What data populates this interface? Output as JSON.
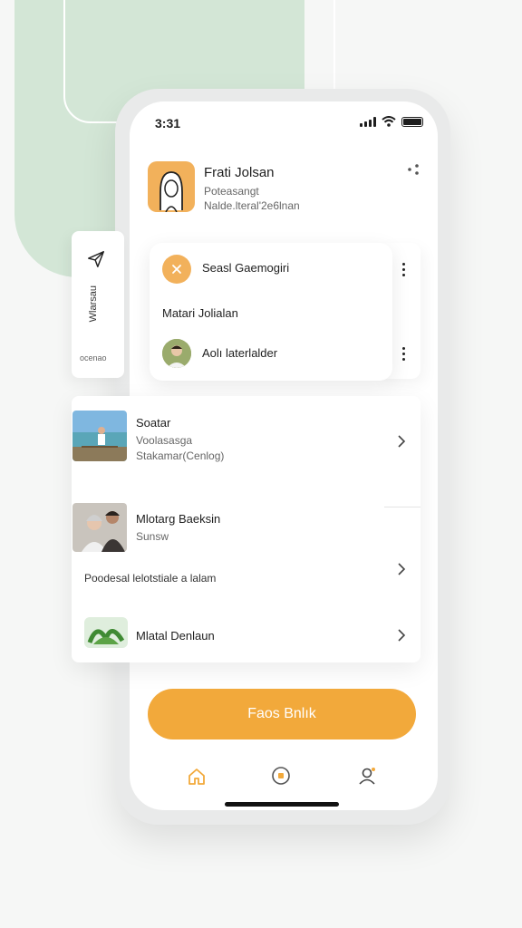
{
  "status": {
    "time": "3:31"
  },
  "profile": {
    "name": "Frati Jolsan",
    "line1": "Poteasangt",
    "line2": "Nalde.lteral'2e6lnan"
  },
  "side_tab": {
    "vertical_label": "Wlarsau",
    "bottom_label": "ocenao"
  },
  "card": {
    "title": "Seasl Gaemogiri",
    "middle": "Matari Jolialan",
    "item": "Aolı laterlalder"
  },
  "list": {
    "items": [
      {
        "title": "Soatar",
        "line1": "Voolasasga",
        "line2": "Stakamar(Cenlog)"
      },
      {
        "title": "Mlotarg Baeksin",
        "line1": "Sunsw",
        "extra": "Poodesal lelotstiale a lalam"
      },
      {
        "title": "Mlatal Denlaun"
      }
    ]
  },
  "cta": {
    "label": "Faos Bnlık"
  },
  "colors": {
    "accent": "#f2a93b",
    "bg_green": "#d3e6d6"
  },
  "icons": {
    "nav": [
      "home-icon",
      "chat-icon",
      "profile-icon"
    ],
    "misc": [
      "share-icon",
      "send-icon",
      "close-icon",
      "more-vertical-icon",
      "chevron-right-icon"
    ]
  }
}
